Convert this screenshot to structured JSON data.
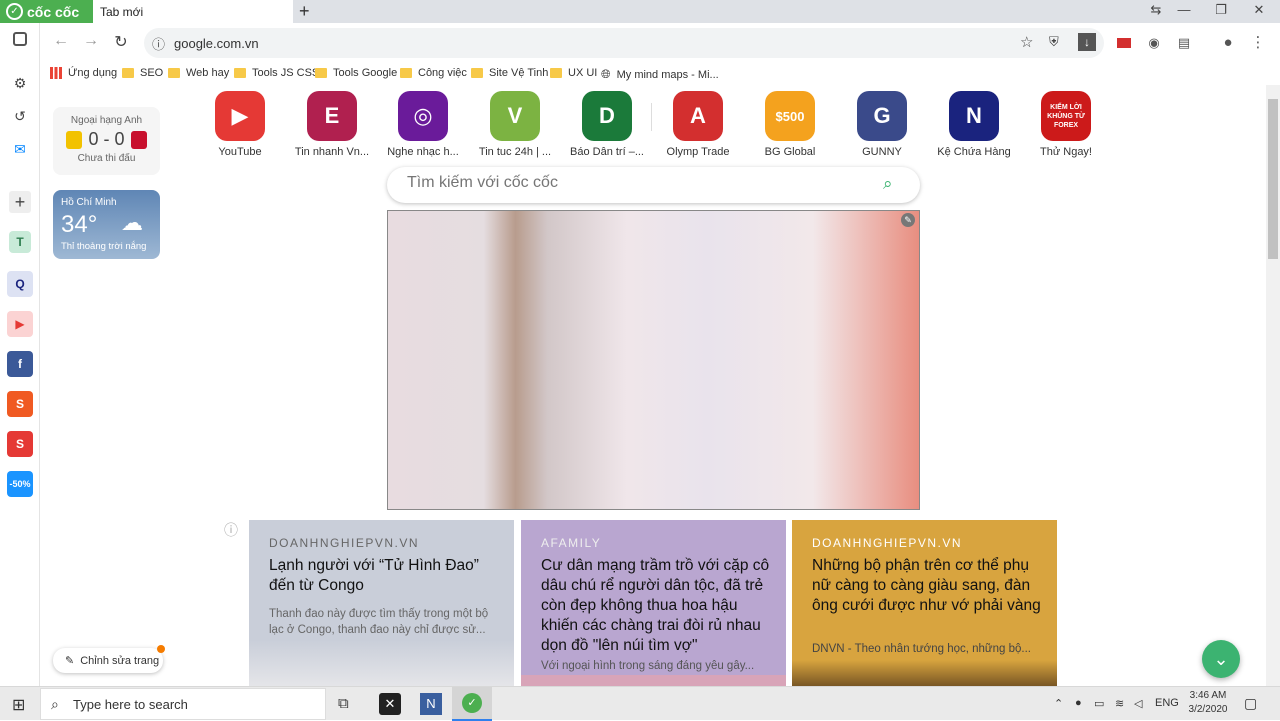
{
  "browser": {
    "brand": "cốc cốc",
    "tab_title": "Tab mới",
    "url": "google.com.vn"
  },
  "bookmarks": [
    {
      "label": "Ứng dụng",
      "type": "apps"
    },
    {
      "label": "SEO",
      "type": "folder"
    },
    {
      "label": "Web hay",
      "type": "folder"
    },
    {
      "label": "Tools JS CSS",
      "type": "folder"
    },
    {
      "label": "Tools Google",
      "type": "folder"
    },
    {
      "label": "Công việc",
      "type": "folder"
    },
    {
      "label": "Site Vệ Tinh",
      "type": "folder"
    },
    {
      "label": "UX UI",
      "type": "folder"
    },
    {
      "label": "My mind maps - Mi...",
      "type": "globe"
    }
  ],
  "football": {
    "league": "Ngoại hạng Anh",
    "score": "0 - 0",
    "status": "Chưa thi đấu"
  },
  "weather": {
    "city": "Hồ Chí Minh",
    "temp": "34°",
    "desc": "Thỉ thoảng trời nắng"
  },
  "speed_dial": [
    {
      "label": "YouTube",
      "color": "#e53935",
      "glyph": "▶"
    },
    {
      "label": "Tin nhanh Vn...",
      "color": "#b0204f",
      "glyph": "E"
    },
    {
      "label": "Nghe nhạc h...",
      "color": "#6a1b9a",
      "glyph": "◎"
    },
    {
      "label": "Tin tuc 24h | ...",
      "color": "#7cb342",
      "glyph": "V"
    },
    {
      "label": "Báo Dân trí –...",
      "color": "#1b7a3a",
      "glyph": "D"
    },
    {
      "label": "Olymp Trade",
      "color": "#d32f2f",
      "glyph": "A"
    },
    {
      "label": "BG Global",
      "color": "#f4a21e",
      "glyph": "$500"
    },
    {
      "label": "GUNNY",
      "color": "#3a4a8a",
      "glyph": "G"
    },
    {
      "label": "Kệ Chứa Hàng",
      "color": "#1a237e",
      "glyph": "N"
    },
    {
      "label": "Thử Ngay!",
      "color": "#cc1a1a",
      "glyph": "KIẾM LỜI KHỦNG TỪ FOREX"
    }
  ],
  "search": {
    "placeholder": "Tìm kiếm với cốc cốc"
  },
  "news": [
    {
      "source": "DOANHNGHIEPVN.VN",
      "title": "Lạnh người với “Tử Hình Đao” đến từ Congo",
      "desc": "Thanh đao này được tìm thấy trong một bộ lạc ở Congo, thanh đao này chỉ được sử...",
      "bg": "#c9ced9",
      "src_color": "#666",
      "title_color": "#111",
      "desc_color": "#666"
    },
    {
      "source": "AFAMILY",
      "title": "Cư dân mạng trầm trồ với cặp cô dâu chú rể người dân tộc, đã trẻ còn đẹp không thua hoa hậu khiến các chàng trai đòi rủ nhau dọn đồ \"lên núi tìm vợ\"",
      "desc": "Với ngoại hình trong sáng đáng yêu gây...",
      "bg": "#b9a6d0",
      "src_color": "#eee",
      "title_color": "#111",
      "desc_color": "#555"
    },
    {
      "source": "DOANHNGHIEPVN.VN",
      "title": "Những bộ phận trên cơ thể phụ nữ càng to càng giàu sang, đàn ông cưới được như vớ phải vàng",
      "desc": "DNVN - Theo nhân tướng học, những bộ...",
      "bg": "#d8a43f",
      "src_color": "#fff",
      "title_color": "#111",
      "desc_color": "#444"
    }
  ],
  "edit_button": "Chỉnh sửa trang",
  "taskbar": {
    "search_placeholder": "Type here to search",
    "lang": "ENG",
    "time": "3:46 AM",
    "date": "3/2/2020"
  }
}
